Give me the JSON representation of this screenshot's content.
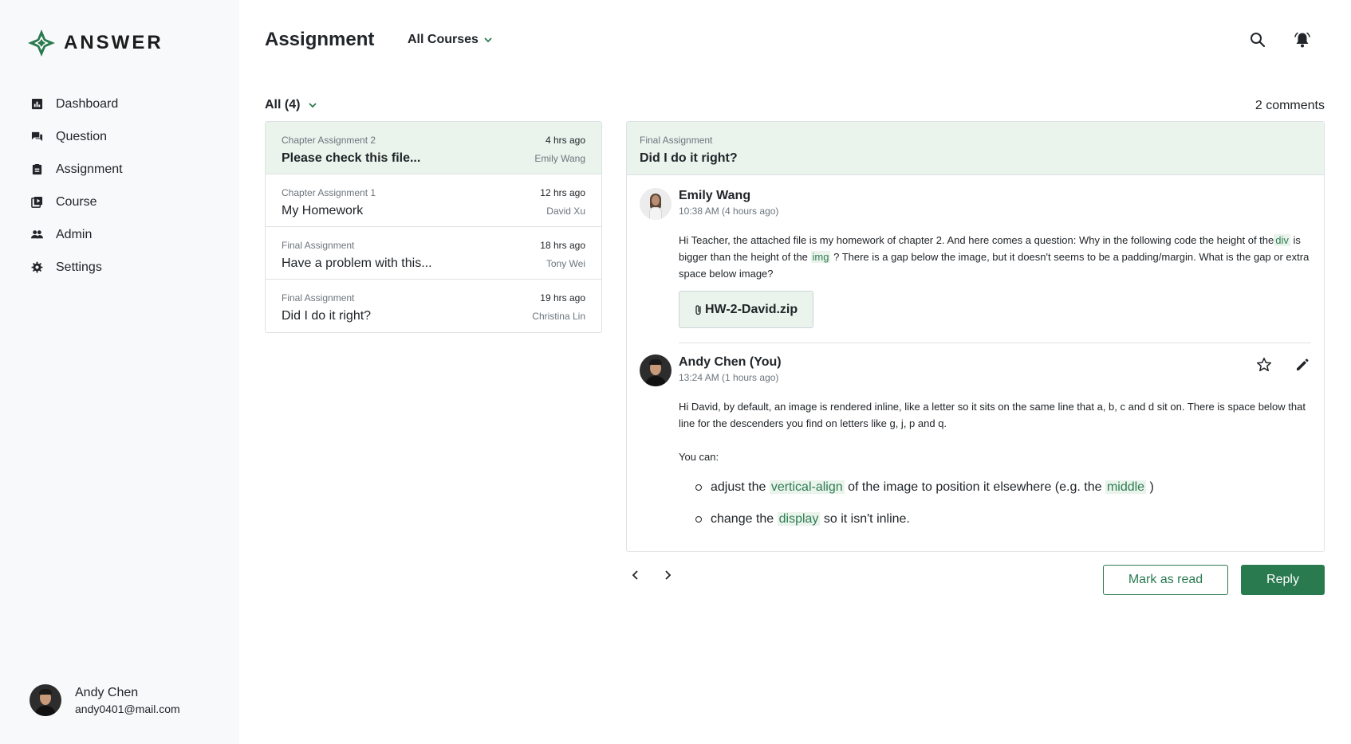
{
  "brand": {
    "name": "ANSWER",
    "accent": "#2a7a50"
  },
  "sidebar": {
    "items": [
      {
        "label": "Dashboard",
        "icon": "chart-icon"
      },
      {
        "label": "Question",
        "icon": "chat-icon"
      },
      {
        "label": "Assignment",
        "icon": "clipboard-icon"
      },
      {
        "label": "Course",
        "icon": "course-icon"
      },
      {
        "label": "Admin",
        "icon": "people-icon"
      },
      {
        "label": "Settings",
        "icon": "gear-icon"
      }
    ],
    "user": {
      "name": "Andy Chen",
      "email": "andy0401@mail.com"
    }
  },
  "header": {
    "title": "Assignment",
    "course_filter": "All Courses"
  },
  "filter": {
    "label": "All (4)",
    "comments_count": "2 comments"
  },
  "assignments": [
    {
      "category": "Chapter Assignment 2",
      "title": "Please check this file...",
      "time": "4 hrs ago",
      "author": "Emily Wang",
      "active": true
    },
    {
      "category": "Chapter Assignment 1",
      "title": "My Homework",
      "time": "12 hrs ago",
      "author": "David Xu",
      "active": false
    },
    {
      "category": "Final Assignment",
      "title": "Have a problem with this...",
      "time": "18 hrs ago",
      "author": "Tony Wei",
      "active": false
    },
    {
      "category": "Final Assignment",
      "title": "Did I do it right?",
      "time": "19 hrs ago",
      "author": "Christina Lin",
      "active": false
    }
  ],
  "detail": {
    "category": "Final Assignment",
    "title": "Did I do it right?",
    "comments": [
      {
        "name": "Emily Wang",
        "time": "10:38 AM (4 hours ago)",
        "text_parts": [
          "Hi Teacher, the attached file is my homework of chapter 2. And here comes a question: Why in the following code the height of the",
          "div",
          " is bigger than the height of the ",
          "img",
          " ? There is a gap below the image, but it doesn't seems to be a padding/margin. What is the gap or extra space below image?"
        ],
        "attachment": "HW-2-David.zip"
      },
      {
        "name": "Andy Chen (You)",
        "time": "13:24 AM (1 hours ago)",
        "paragraph": "Hi David, by default, an image is rendered inline, like a letter so it sits on the same line that a, b, c and d sit on. There is space below that line for the descenders you find on letters like g, j, p and q.",
        "intro": "You can:",
        "bullets": [
          {
            "before": "adjust the ",
            "code": "vertical-align",
            "middle": " of the image to position it elsewhere (e.g. the ",
            "code2": "middle",
            "after": " )"
          },
          {
            "before": "change the ",
            "code": "display",
            "after": " so it isn't inline."
          }
        ]
      }
    ]
  },
  "actions": {
    "mark_read": "Mark as read",
    "reply": "Reply"
  }
}
